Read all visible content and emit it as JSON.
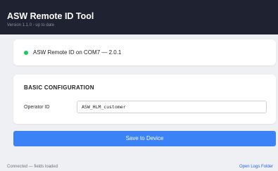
{
  "header": {
    "title": "ASW Remote ID Tool",
    "version": "Version 1.1.0 - up to date"
  },
  "status": {
    "text": "ASW Remote ID on COM7 — 2.0.1",
    "indicator_color": "#22c55e",
    "indicator_icon": "status-dot-icon"
  },
  "config": {
    "section_title": "BASIC CONFIGURATION",
    "operator_id_label": "Operator ID",
    "operator_id_value": "ASW_HLM_customer"
  },
  "actions": {
    "save_label": "Save to Device",
    "accent_color": "#3b82f6"
  },
  "footer": {
    "status": "Connected — fields loaded",
    "logs_link": "Open Logs Folder"
  }
}
